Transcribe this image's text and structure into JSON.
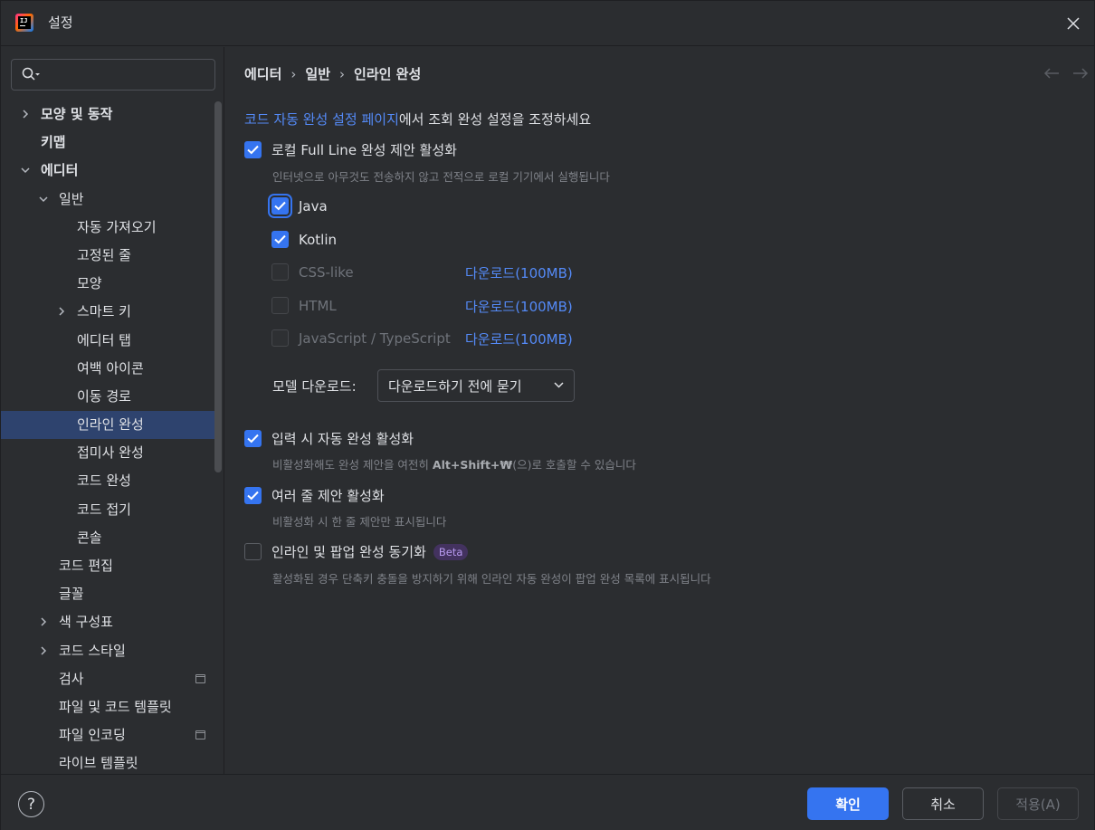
{
  "window": {
    "title": "설정"
  },
  "sidebar": {
    "search_placeholder": "",
    "items": [
      {
        "label": "모양 및 동작",
        "level": 0,
        "expandable": true,
        "expanded": false,
        "bold": true
      },
      {
        "label": "키맵",
        "level": 0,
        "expandable": false,
        "bold": true
      },
      {
        "label": "에디터",
        "level": 0,
        "expandable": true,
        "expanded": true,
        "bold": true
      },
      {
        "label": "일반",
        "level": 1,
        "expandable": true,
        "expanded": true
      },
      {
        "label": "자동 가져오기",
        "level": 2
      },
      {
        "label": "고정된 줄",
        "level": 2
      },
      {
        "label": "모양",
        "level": 2
      },
      {
        "label": "스마트 키",
        "level": 2,
        "expandable": true,
        "expanded": false
      },
      {
        "label": "에디터 탭",
        "level": 2
      },
      {
        "label": "여백 아이콘",
        "level": 2
      },
      {
        "label": "이동 경로",
        "level": 2
      },
      {
        "label": "인라인 완성",
        "level": 2,
        "selected": true
      },
      {
        "label": "접미사 완성",
        "level": 2
      },
      {
        "label": "코드 완성",
        "level": 2
      },
      {
        "label": "코드 접기",
        "level": 2
      },
      {
        "label": "콘솔",
        "level": 2
      },
      {
        "label": "코드 편집",
        "level": 1
      },
      {
        "label": "글꼴",
        "level": 1
      },
      {
        "label": "색 구성표",
        "level": 1,
        "expandable": true,
        "expanded": false
      },
      {
        "label": "코드 스타일",
        "level": 1,
        "expandable": true,
        "expanded": false
      },
      {
        "label": "검사",
        "level": 1,
        "icon": "project-scope-icon"
      },
      {
        "label": "파일 및 코드 템플릿",
        "level": 1
      },
      {
        "label": "파일 인코딩",
        "level": 1,
        "icon": "project-scope-icon"
      },
      {
        "label": "라이브 템플릿",
        "level": 1
      }
    ]
  },
  "breadcrumb": [
    "에디터",
    "일반",
    "인라인 완성"
  ],
  "content": {
    "intro_link": "코드 자동 완성 설정 페이지",
    "intro_suffix": "에서 조회 완성 설정을 조정하세요",
    "full_line": {
      "label": "로컬 Full Line 완성 제안 활성화",
      "checked": true,
      "description": "인터넷으로 아무것도 전송하지 않고 전적으로 로컬 기기에서 실행됩니다"
    },
    "languages": [
      {
        "name": "Java",
        "checked": true,
        "enabled": true
      },
      {
        "name": "Kotlin",
        "checked": true,
        "enabled": true
      },
      {
        "name": "CSS-like",
        "checked": false,
        "enabled": false,
        "download": "다운로드(100MB)"
      },
      {
        "name": "HTML",
        "checked": false,
        "enabled": false,
        "download": "다운로드(100MB)"
      },
      {
        "name": "JavaScript / TypeScript",
        "checked": false,
        "enabled": false,
        "download": "다운로드(100MB)"
      }
    ],
    "model_download": {
      "label": "모델 다운로드:",
      "value": "다운로드하기 전에 묻기"
    },
    "autocomplete_typing": {
      "label": "입력 시 자동 완성 활성화",
      "checked": true,
      "description_prefix": "비활성화해도 완성 제안을 여전히 ",
      "description_shortcut": "Alt+Shift+₩",
      "description_suffix": "(으)로 호출할 수 있습니다"
    },
    "multiline": {
      "label": "여러 줄 제안 활성화",
      "checked": true,
      "description": "비활성화 시 한 줄 제안만 표시됩니다"
    },
    "sync_popup": {
      "label": "인라인 및 팝업 완성 동기화",
      "checked": false,
      "badge": "Beta",
      "description": "활성화된 경우 단축키 충돌을 방지하기 위해 인라인 자동 완성이 팝업 완성 목록에 표시됩니다"
    }
  },
  "footer": {
    "help": "?",
    "ok": "확인",
    "cancel": "취소",
    "apply": "적용(A)"
  },
  "colors": {
    "accent": "#3574f0",
    "link": "#548af7",
    "selected_row": "#2e436e",
    "background": "#2b2d30",
    "beta_bg": "#43325f",
    "beta_text": "#b89af0"
  }
}
